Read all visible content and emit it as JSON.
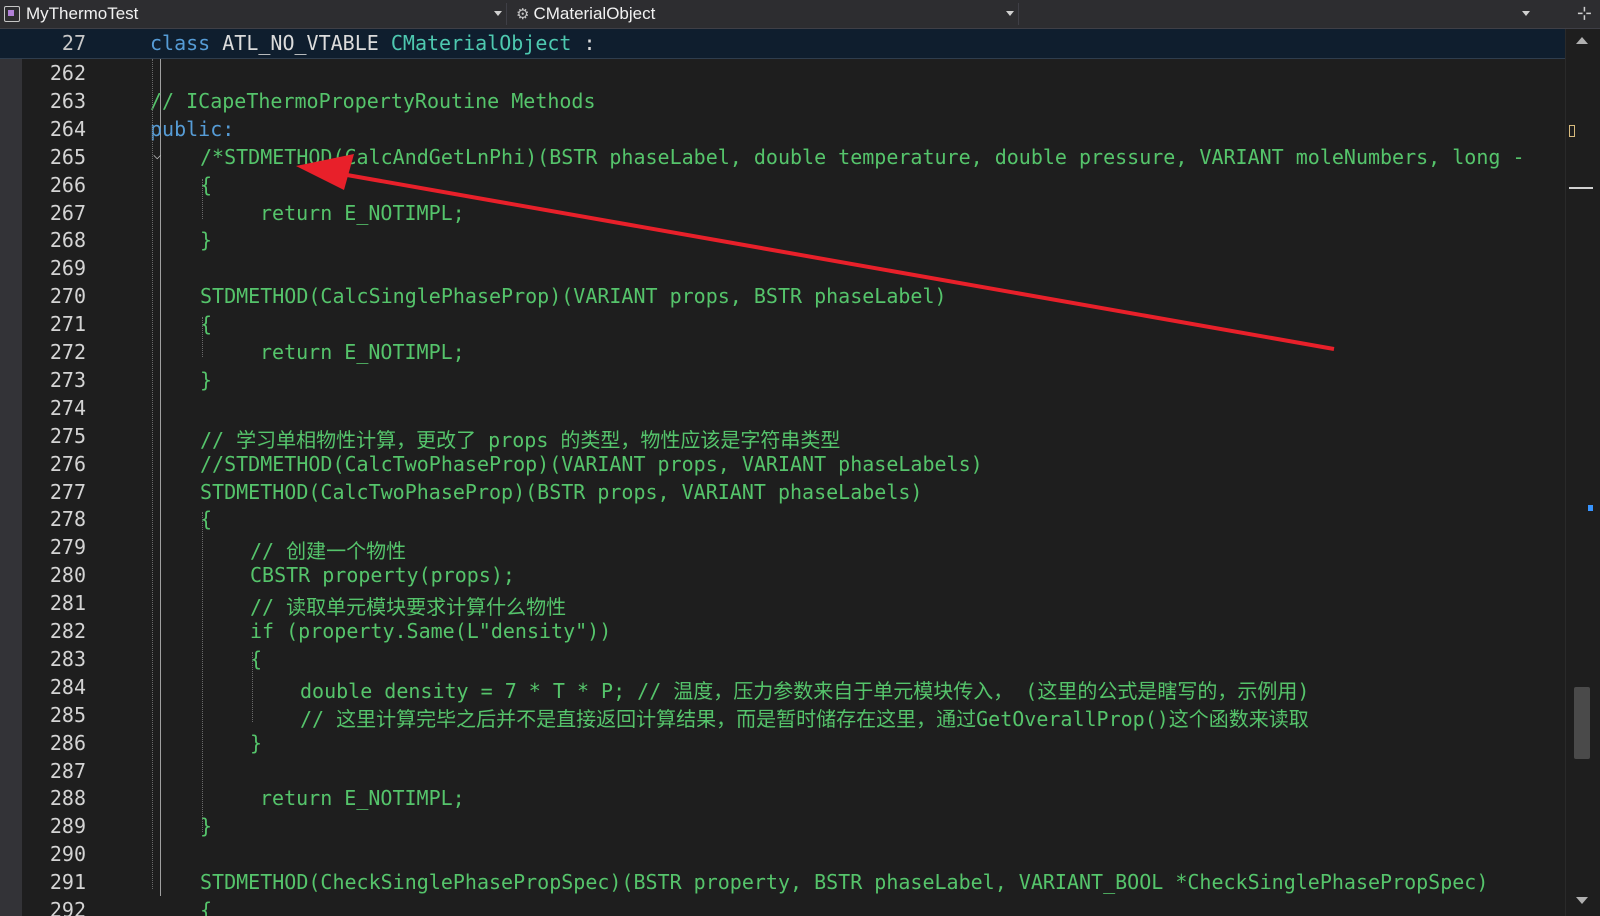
{
  "toolbar": {
    "project": "MyThermoTest",
    "class_scope": "CMaterialObject",
    "member_scope": ""
  },
  "sticky": {
    "line": "27",
    "keyword": "class",
    "macro": "ATL_NO_VTABLE",
    "classname": "CMaterialObject",
    "rest": " :"
  },
  "lines": [
    {
      "n": "262",
      "t": ""
    },
    {
      "n": "263",
      "t": "// ICapeThermoPropertyRoutine Methods"
    },
    {
      "n": "264",
      "t": "public:"
    },
    {
      "n": "265",
      "t": "/*STDMETHOD(CalcAndGetLnPhi)(BSTR phaseLabel, double temperature, double pressure, VARIANT moleNumbers, long -"
    },
    {
      "n": "266",
      "t": "{"
    },
    {
      "n": "267",
      "t": "return E_NOTIMPL;"
    },
    {
      "n": "268",
      "t": "}"
    },
    {
      "n": "269",
      "t": ""
    },
    {
      "n": "270",
      "t": "STDMETHOD(CalcSinglePhaseProp)(VARIANT props, BSTR phaseLabel)"
    },
    {
      "n": "271",
      "t": "{"
    },
    {
      "n": "272",
      "t": "return E_NOTIMPL;"
    },
    {
      "n": "273",
      "t": "}"
    },
    {
      "n": "274",
      "t": ""
    },
    {
      "n": "275",
      "t": "// 学习单相物性计算，更改了 props 的类型，物性应该是字符串类型"
    },
    {
      "n": "276",
      "t": "//STDMETHOD(CalcTwoPhaseProp)(VARIANT props, VARIANT phaseLabels)"
    },
    {
      "n": "277",
      "t": "STDMETHOD(CalcTwoPhaseProp)(BSTR props, VARIANT phaseLabels)"
    },
    {
      "n": "278",
      "t": "{"
    },
    {
      "n": "279",
      "t": "// 创建一个物性"
    },
    {
      "n": "280",
      "t": "CBSTR property(props);"
    },
    {
      "n": "281",
      "t": "// 读取单元模块要求计算什么物性"
    },
    {
      "n": "282",
      "t": "if (property.Same(L\"density\"))"
    },
    {
      "n": "283",
      "t": "{"
    },
    {
      "n": "284",
      "t": "double density = 7 * T * P; // 温度，压力参数来自于单元模块传入， (这里的公式是瞎写的，示例用)"
    },
    {
      "n": "285",
      "t": "// 这里计算完毕之后并不是直接返回计算结果，而是暂时储存在这里，通过GetOverallProp()这个函数来读取"
    },
    {
      "n": "286",
      "t": "}"
    },
    {
      "n": "287",
      "t": ""
    },
    {
      "n": "288",
      "t": "return E_NOTIMPL;"
    },
    {
      "n": "289",
      "t": "}"
    },
    {
      "n": "290",
      "t": ""
    },
    {
      "n": "291",
      "t": "STDMETHOD(CheckSinglePhasePropSpec)(BSTR property, BSTR phaseLabel, VARIANT_BOOL *CheckSinglePhasePropSpec)"
    },
    {
      "n": "292",
      "t": "{"
    }
  ],
  "colors": {
    "background": "#1e1e1e",
    "code_green": "#55c46b",
    "keyword_blue": "#569cd6",
    "class_teal": "#4ec9b0",
    "arrow_red": "#e8202a"
  },
  "icons": {
    "project": "cpp-project-icon",
    "class": "class-members-icon",
    "split": "split-window-icon",
    "fold": "collapse-chevron-icon"
  }
}
